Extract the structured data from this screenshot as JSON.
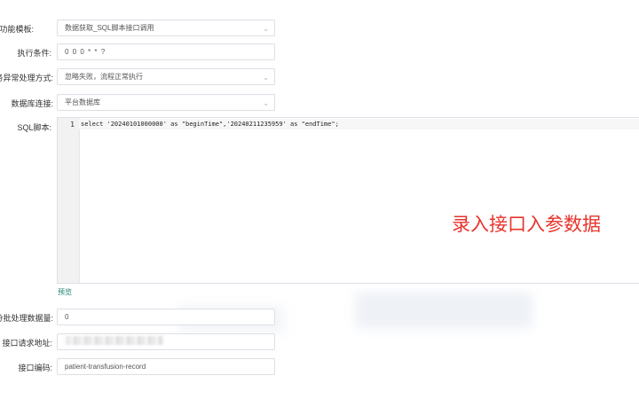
{
  "form": {
    "template_label": "择功能模板",
    "template_value": "数据获取_SQL脚本接口调用",
    "condition_label": "执行条件",
    "condition_value": "0 0 0 * * ?",
    "error_label": "务异常处理方式",
    "error_value": "忽略失败，流程正常执行",
    "db_label": "数据库连接",
    "db_value": "平台数据库",
    "sql_label": "SQL脚本",
    "sql_line_number": "1",
    "sql_code": "select '20240101000000' as \"beginTime\",'20240211235959' as \"endTime\";",
    "preview_label": "预览",
    "batch_label": "分批处理数据量",
    "batch_value": "0",
    "url_label": "接口请求地址",
    "url_value": "",
    "code_label": "接口编码",
    "code_value": "patient-transfusion-record"
  },
  "overlay_caption": "录入接口入参数据",
  "icons": {
    "dropdown": "chevron-down-icon"
  },
  "colors": {
    "accent_link": "#1a7f6a",
    "caption": "#e8332b",
    "border": "#dcdfe6"
  }
}
